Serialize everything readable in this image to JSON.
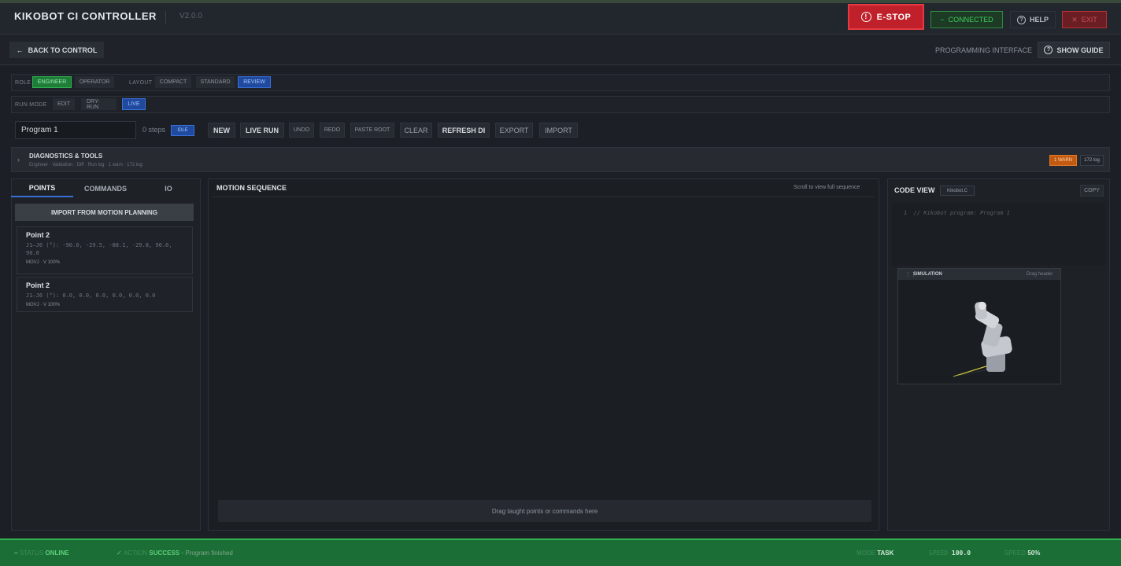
{
  "header": {
    "app_title": "KIKOBOT CI CONTROLLER",
    "version": "V2.0.0",
    "estop_label": "E-STOP",
    "estop_icon": "!",
    "connected_label": "CONNECTED",
    "connected_icon": "~",
    "help_label": "HELP",
    "help_icon": "?",
    "exit_label": "EXIT",
    "exit_icon": "✕"
  },
  "subheader": {
    "back_label": "BACK TO CONTROL",
    "back_icon": "←",
    "interface_label": "PROGRAMMING INTERFACE",
    "guide_label": "SHOW GUIDE",
    "guide_icon": "?"
  },
  "role_row": {
    "role_label": "ROLE",
    "engineer": "ENGINEER",
    "operator": "OPERATOR",
    "layout_label": "LAYOUT",
    "compact": "COMPACT",
    "standard": "STANDARD",
    "review": "REVIEW"
  },
  "mode_row": {
    "run_mode_label": "RUN MODE",
    "edit": "EDIT",
    "dry_run": "DRY-RUN",
    "live": "LIVE"
  },
  "program": {
    "name": "Program 1",
    "steps": "0 steps",
    "state_badge": "IDLE",
    "buttons": {
      "new": "NEW",
      "live_run": "LIVE RUN",
      "undo": "UNDO",
      "redo": "REDO",
      "paste_root": "PASTE ROOT",
      "clear": "CLEAR",
      "refresh_di": "REFRESH DI",
      "export": "EXPORT",
      "import": "IMPORT"
    }
  },
  "diagnostics": {
    "chevron": "›",
    "title": "DIAGNOSTICS & TOOLS",
    "subtitle": "Engineer · Validation · Diff · Run log · 1 warn · 172 log",
    "warn_badge": "1 WARN",
    "log_badge": "172 log"
  },
  "left_panel": {
    "tabs": [
      "POINTS",
      "COMMANDS",
      "IO"
    ],
    "import_button": "IMPORT FROM MOTION PLANNING",
    "points": [
      {
        "title": "Point 2",
        "joints": "J1–J6 (°): -90.0, -29.5, -88.1, -29.8, 90.0, 90.0",
        "meta": "MOVJ · V 100%"
      },
      {
        "title": "Point 2",
        "joints": "J1–J6 (°): 0.0, 0.0, 0.0, 0.0, 0.0, 0.0",
        "meta": "MOVJ · V 100%"
      }
    ]
  },
  "motion_sequence": {
    "title": "MOTION SEQUENCE",
    "hint": "Scroll to view full sequence",
    "dropzone": "Drag taught points or commands here"
  },
  "code_view": {
    "title": "CODE VIEW",
    "file_tag": "Kikobot.C",
    "copy_label": "COPY",
    "line_number": "1",
    "code_line": "// Kikobot program: Program 1"
  },
  "simulation": {
    "grip_icon": "⋮⋮",
    "title": "SIMULATION",
    "drag_hint": "Drag header"
  },
  "status_bar": {
    "status_key": "STATUS",
    "status_value": "ONLINE",
    "action_key": "ACTION",
    "action_value": "SUCCESS",
    "action_detail": "Program finished",
    "mode_key": "MODE",
    "mode_value": "TASK",
    "speed_key": "SPEED",
    "speed_value": "100.0",
    "gain_key": "SPEED",
    "gain_value": "50%",
    "online_icon": "~",
    "success_icon": "✓",
    "bullet": "•"
  }
}
